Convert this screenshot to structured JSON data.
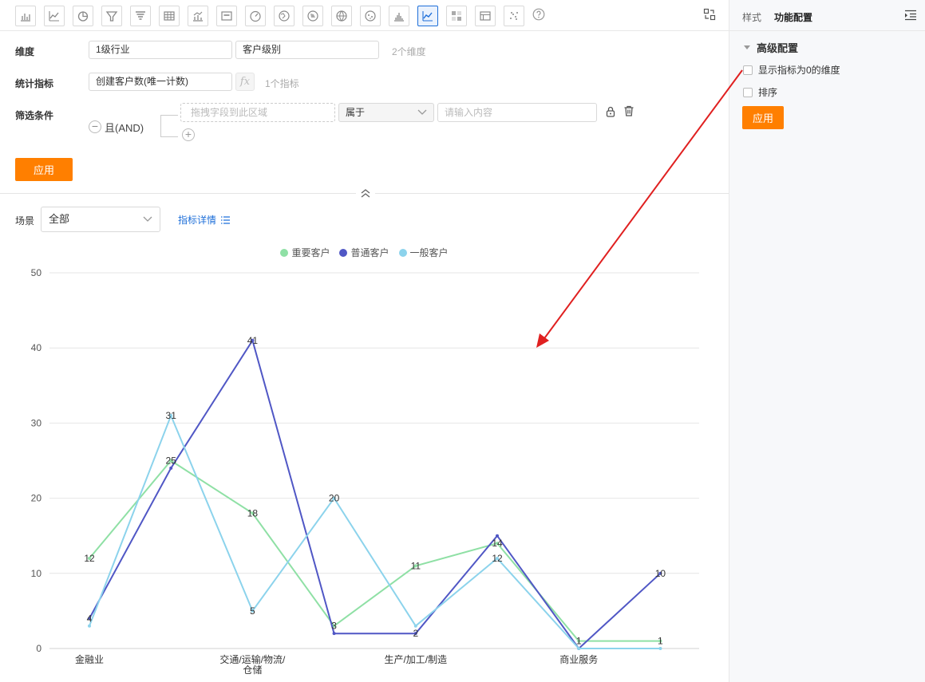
{
  "toolbar": {
    "icons": [
      "bar-chart-icon",
      "line-chart-icon",
      "pie-chart-icon",
      "funnel-icon",
      "funnel-alt-icon",
      "table-icon",
      "combo-chart-icon",
      "card-icon",
      "gauge-icon",
      "map-icon",
      "map-alt-icon",
      "globe-icon",
      "scatter-map-icon",
      "histogram-icon",
      "line-area-icon",
      "heatmap-icon",
      "pivot-icon",
      "scatter-icon"
    ],
    "active_index": 14
  },
  "config": {
    "dimension_label": "维度",
    "dimension_1": "1级行业",
    "dimension_2": "客户级别",
    "dimension_count": "2个维度",
    "metric_label": "统计指标",
    "metric_1": "创建客户数(唯一计数)",
    "fx_label": "fx",
    "metric_count": "1个指标",
    "filter_label": "筛选条件",
    "and_label": "且(AND)",
    "drop_placeholder": "拖拽字段到此区域",
    "operator": "属于",
    "value_placeholder": "请输入内容",
    "apply_label": "应用"
  },
  "scene": {
    "label": "场景",
    "value": "全部",
    "detail_link": "指标详情"
  },
  "right_panel": {
    "tab_style": "样式",
    "tab_function": "功能配置",
    "section_title": "高级配置",
    "option_show_zero": "显示指标为0的维度",
    "option_sort": "排序",
    "apply_label": "应用"
  },
  "chart_data": {
    "type": "line",
    "x": [
      "金融业",
      "交通/运输/物流/仓储",
      "生产/加工/制造",
      "商业服务"
    ],
    "ylim": [
      0,
      50
    ],
    "yticks": [
      0,
      10,
      20,
      30,
      40,
      50
    ],
    "legend_position": "top-center",
    "grid": true,
    "series": [
      {
        "name": "重要客户",
        "color": "#8fe0a5",
        "points": [
          [
            0,
            12
          ],
          [
            0.5,
            25
          ],
          [
            1,
            18
          ],
          [
            1.5,
            3
          ],
          [
            2,
            11
          ],
          [
            2.5,
            14
          ],
          [
            3,
            1
          ],
          [
            3.5,
            1
          ]
        ]
      },
      {
        "name": "普通客户",
        "color": "#5057c5",
        "points": [
          [
            0,
            4
          ],
          [
            0.5,
            24
          ],
          [
            1,
            41
          ],
          [
            1.5,
            2
          ],
          [
            2,
            2
          ],
          [
            2.5,
            15
          ],
          [
            3,
            0
          ],
          [
            3.5,
            10
          ]
        ]
      },
      {
        "name": "一般客户",
        "color": "#8cd3ec",
        "points": [
          [
            0,
            3
          ],
          [
            0.5,
            31
          ],
          [
            1,
            5
          ],
          [
            1.5,
            20
          ],
          [
            2,
            3
          ],
          [
            2.5,
            12
          ],
          [
            3,
            0
          ],
          [
            3.5,
            0
          ]
        ]
      }
    ],
    "data_labels": [
      {
        "x": 0,
        "y": 12,
        "text": "12"
      },
      {
        "x": 0,
        "y": 4,
        "text": "4"
      },
      {
        "x": 0.5,
        "y": 31,
        "text": "31"
      },
      {
        "x": 0.5,
        "y": 25,
        "text": "25"
      },
      {
        "x": 1,
        "y": 41,
        "text": "41"
      },
      {
        "x": 1,
        "y": 18,
        "text": "18"
      },
      {
        "x": 1,
        "y": 5,
        "text": "5"
      },
      {
        "x": 1.5,
        "y": 20,
        "text": "20"
      },
      {
        "x": 1.5,
        "y": 3,
        "text": "3"
      },
      {
        "x": 2,
        "y": 11,
        "text": "11"
      },
      {
        "x": 2,
        "y": 2,
        "text": "2"
      },
      {
        "x": 2.5,
        "y": 14,
        "text": "14"
      },
      {
        "x": 2.5,
        "y": 12,
        "text": "12"
      },
      {
        "x": 3,
        "y": 1,
        "text": "1"
      },
      {
        "x": 3.5,
        "y": 10,
        "text": "10"
      },
      {
        "x": 3.5,
        "y": 1,
        "text": "1"
      }
    ]
  },
  "annotation": {
    "arrow_color": "#e02020"
  }
}
